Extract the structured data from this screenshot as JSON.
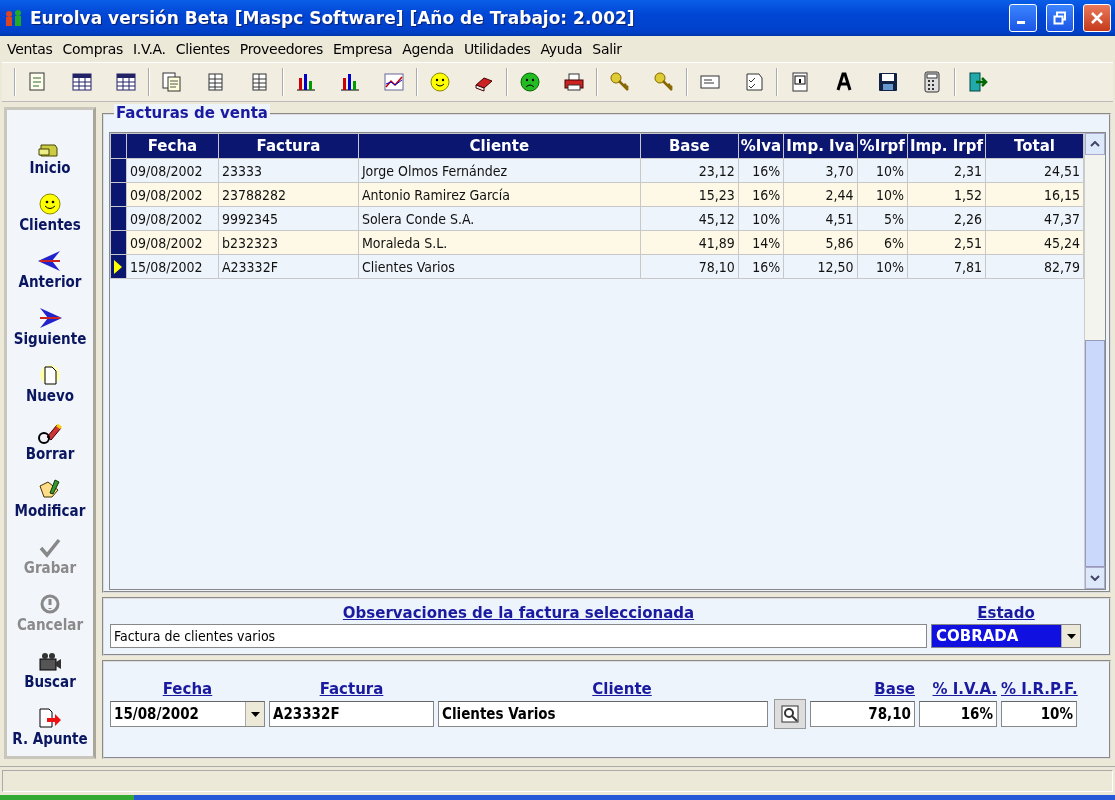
{
  "window": {
    "title": "Eurolva versión Beta [Maspc Software] [Año de Trabajo: 2.002]"
  },
  "menu": [
    "Ventas",
    "Compras",
    "I.V.A.",
    "Clientes",
    "Proveedores",
    "Empresa",
    "Agenda",
    "Utilidades",
    "Ayuda",
    "Salir"
  ],
  "sidebar": [
    {
      "label": "Inicio",
      "disabled": false
    },
    {
      "label": "Clientes",
      "disabled": false
    },
    {
      "label": "Anterior",
      "disabled": false
    },
    {
      "label": "Siguiente",
      "disabled": false
    },
    {
      "label": "Nuevo",
      "disabled": false
    },
    {
      "label": "Borrar",
      "disabled": false
    },
    {
      "label": "Modificar",
      "disabled": false
    },
    {
      "label": "Grabar",
      "disabled": true
    },
    {
      "label": "Cancelar",
      "disabled": true
    },
    {
      "label": "Buscar",
      "disabled": false
    },
    {
      "label": "R. Apunte",
      "disabled": false
    }
  ],
  "grid": {
    "title": "Facturas de venta",
    "columns": [
      "Fecha",
      "Factura",
      "Cliente",
      "Base",
      "%Iva",
      "Imp. Iva",
      "%Irpf",
      "Imp. Irpf",
      "Total"
    ],
    "rows": [
      {
        "selected": false,
        "cells": [
          "09/08/2002",
          "23333",
          "Jorge Olmos Fernández",
          "23,12",
          "16%",
          "3,70",
          "10%",
          "2,31",
          "24,51"
        ]
      },
      {
        "selected": false,
        "cells": [
          "09/08/2002",
          "23788282",
          "Antonio Ramirez García",
          "15,23",
          "16%",
          "2,44",
          "10%",
          "1,52",
          "16,15"
        ]
      },
      {
        "selected": false,
        "cells": [
          "09/08/2002",
          "9992345",
          "Solera Conde S.A.",
          "45,12",
          "10%",
          "4,51",
          "5%",
          "2,26",
          "47,37"
        ]
      },
      {
        "selected": false,
        "cells": [
          "09/08/2002",
          "b232323",
          "Moraleda S.L.",
          "41,89",
          "14%",
          "5,86",
          "6%",
          "2,51",
          "45,24"
        ]
      },
      {
        "selected": true,
        "cells": [
          "15/08/2002",
          "A23332F",
          "Clientes Varios",
          "78,10",
          "16%",
          "12,50",
          "10%",
          "7,81",
          "82,79"
        ]
      }
    ]
  },
  "observations": {
    "label": "Observaciones de la factura seleccionada",
    "value": "Factura de clientes varios"
  },
  "estado": {
    "label": "Estado",
    "value": "COBRADA"
  },
  "edit": [
    {
      "label": "Fecha",
      "value": "15/08/2002",
      "kind": "dropdown"
    },
    {
      "label": "Factura",
      "value": "A23332F",
      "kind": "text"
    },
    {
      "label": "Cliente",
      "value": "Clientes Varios",
      "kind": "lookup"
    },
    {
      "label": "Base",
      "value": "78,10",
      "kind": "number"
    },
    {
      "label": "% I.V.A.",
      "value": "16%",
      "kind": "number"
    },
    {
      "label": "% I.R.P.F.",
      "value": "10%",
      "kind": "number"
    }
  ]
}
